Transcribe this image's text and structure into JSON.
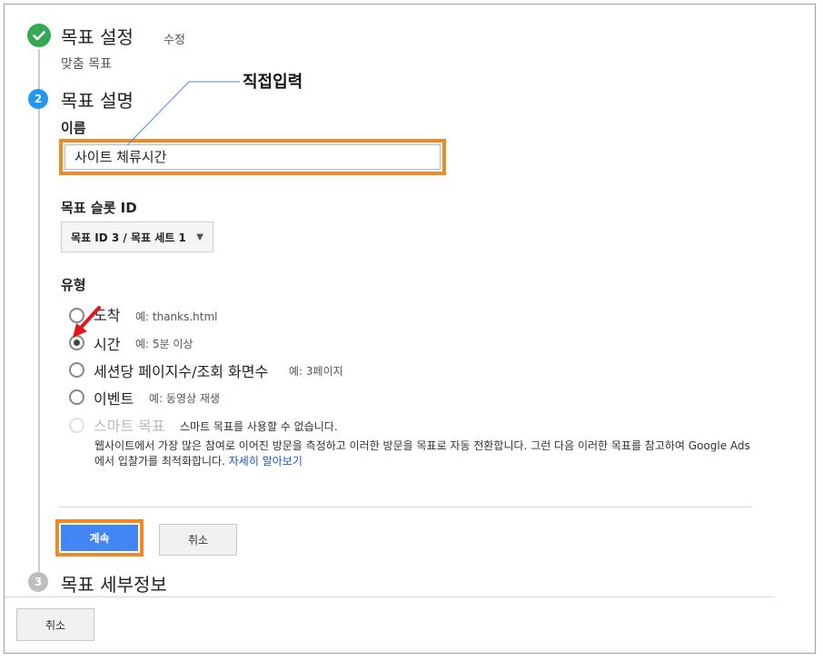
{
  "steps": {
    "step1": {
      "title": "목표 설정",
      "edit_label": "수정",
      "summary": "맞춤 목표"
    },
    "step2": {
      "number": "2",
      "title": "목표 설명"
    },
    "step3": {
      "number": "3",
      "title": "목표 세부정보"
    }
  },
  "annotation": {
    "text": "직접입력"
  },
  "name_field": {
    "label": "이름",
    "value": "사이트 체류시간"
  },
  "slot_field": {
    "label": "목표 슬롯 ID",
    "selected": "목표 ID 3 / 목표 세트 1"
  },
  "type_field": {
    "label": "유형",
    "options": [
      {
        "label": "도착",
        "example": "예: thanks.html",
        "checked": false
      },
      {
        "label": "시간",
        "example": "예: 5분 이상",
        "checked": true
      },
      {
        "label": "세션당 페이지수/조회 화면수",
        "example": "예: 3페이지",
        "checked": false
      },
      {
        "label": "이벤트",
        "example": "예: 동영상 재생",
        "checked": false
      },
      {
        "label": "스마트 목표",
        "example": "스마트 목표를 사용할 수 없습니다.",
        "disabled": true
      }
    ],
    "smart_desc": "웹사이트에서 가장 많은 참여로 이어진 방문을 측정하고 이러한 방문을 목표로 자동 전환합니다. 그런 다음 이러한 목표를 참고하여 Google Ads에서 입찰가를 최적화합니다.",
    "smart_link": "자세히 알아보기"
  },
  "buttons": {
    "continue": "계속",
    "cancel": "취소",
    "bottom_cancel": "취소"
  },
  "colors": {
    "highlight": "#f08a24",
    "primary": "#4285f4",
    "success": "#34a853",
    "step_active": "#2196f3",
    "arrow": "#e8141b"
  },
  "icons": {
    "step1": "check-icon",
    "arrow": "red-arrow-icon",
    "caret": "caret-down-icon"
  }
}
